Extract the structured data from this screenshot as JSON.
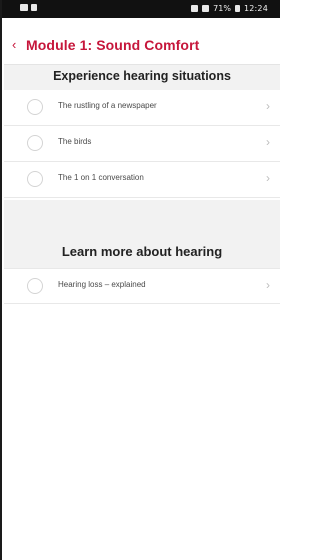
{
  "status_bar": {
    "left_icons": [
      "sim-icon",
      "notification-icon"
    ],
    "time": "12:24",
    "battery": "71%"
  },
  "header": {
    "back_label": "‹",
    "title": "Module 1: Sound Comfort"
  },
  "sections": [
    {
      "title": "Experience hearing situations",
      "items": [
        {
          "label": "The rustling of a newspaper"
        },
        {
          "label": "The birds"
        },
        {
          "label": "The 1 on 1 conversation"
        }
      ]
    },
    {
      "title": "Learn more about hearing",
      "items": [
        {
          "label": "Hearing loss – explained"
        }
      ]
    }
  ],
  "colors": {
    "accent": "#c6163b",
    "section_bg": "#f2f2f2",
    "status_bar_bg": "#111111"
  },
  "icons": {
    "item_chevron": "chevron-right-icon",
    "item_status": "radio-empty-icon"
  }
}
